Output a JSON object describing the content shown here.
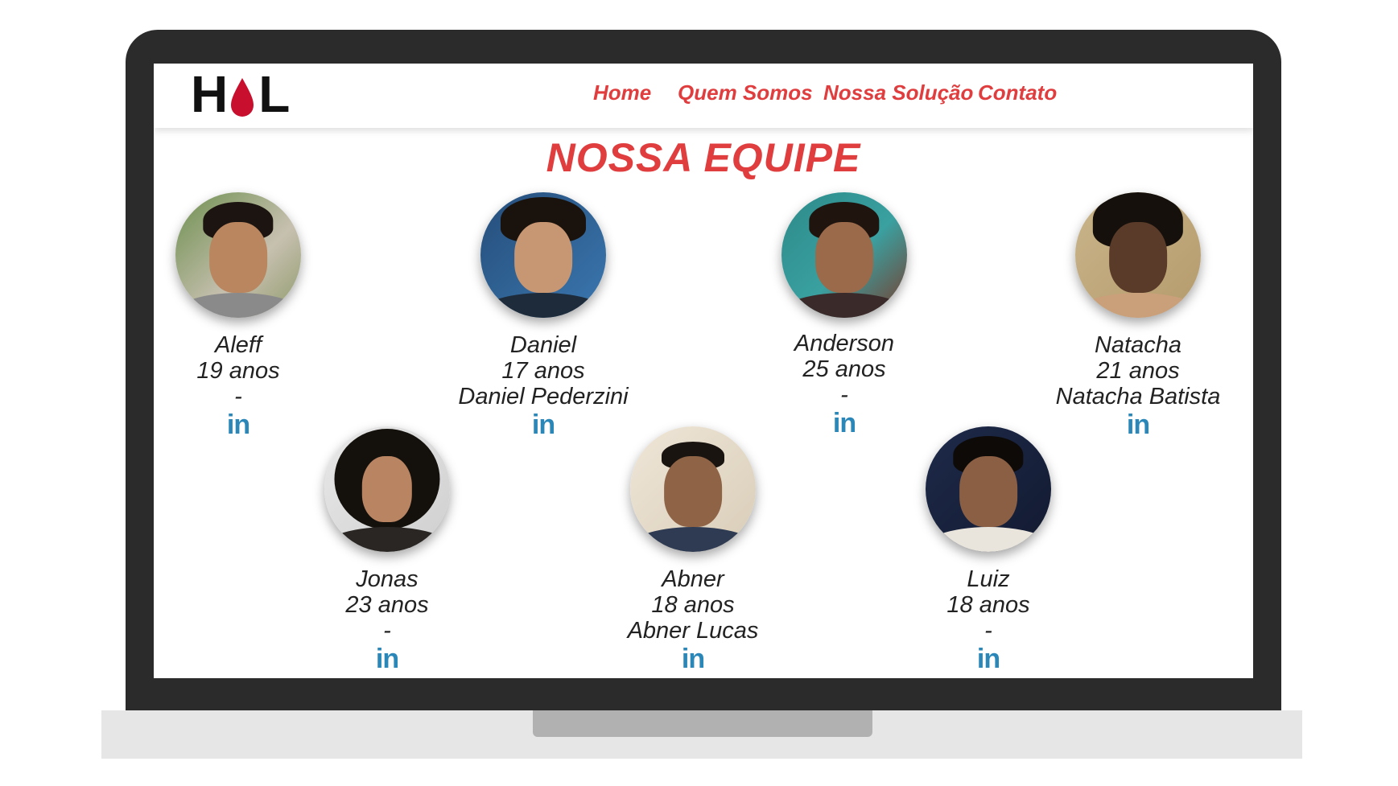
{
  "nav": {
    "items": [
      "Home",
      "Quem Somos",
      "Nossa Solução",
      "Contato"
    ]
  },
  "logo": {
    "text_left": "H",
    "text_right": "L"
  },
  "page_title": "NOSSA EQUIPE",
  "members": [
    {
      "name": "Aleff",
      "age": "19 anos",
      "extra": "-",
      "linkedin": "in"
    },
    {
      "name": "Daniel",
      "age": "17 anos",
      "extra": "Daniel Pederzini",
      "linkedin": "in"
    },
    {
      "name": "Anderson",
      "age": "25 anos",
      "extra": "-",
      "linkedin": "in"
    },
    {
      "name": "Natacha",
      "age": "21 anos",
      "extra": "Natacha Batista",
      "linkedin": "in"
    },
    {
      "name": "Jonas",
      "age": "23 anos",
      "extra": "-",
      "linkedin": "in"
    },
    {
      "name": "Abner",
      "age": "18 anos",
      "extra": "Abner Lucas",
      "linkedin": "in"
    },
    {
      "name": "Luiz",
      "age": "18 anos",
      "extra": "-",
      "linkedin": "in"
    }
  ],
  "colors": {
    "accent": "#e03d3f",
    "linkedin": "#2b87b8",
    "frame": "#2b2b2b"
  }
}
